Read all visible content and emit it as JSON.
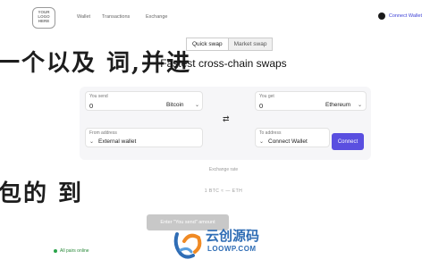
{
  "logo": {
    "line1": "YOUR",
    "line2": "LOGO",
    "line3": "HERE"
  },
  "nav": {
    "wallet": "Wallet",
    "transactions": "Transactions",
    "exchange": "Exchange"
  },
  "header": {
    "connect": "Connect Wallet"
  },
  "watermark": {
    "line1": "一个以及 词,并进",
    "line2": "包的 到"
  },
  "tabs": {
    "quick": "Quick swap",
    "market": "Market swap"
  },
  "subtitle": "Fastest cross-chain swaps",
  "send": {
    "label": "You send",
    "amount": "0",
    "currency": "Bitcoin"
  },
  "get": {
    "label": "You get",
    "amount": "0",
    "currency": "Ethereum"
  },
  "from": {
    "label": "From address",
    "value": "External wallet"
  },
  "to": {
    "label": "To address",
    "value": "Connect Wallet"
  },
  "buttons": {
    "connect": "Connect",
    "enter": "Enter \"You send\" amount"
  },
  "info": {
    "line1": "Exchange rate",
    "line2": "1 BTC ≈ — ETH"
  },
  "footer": {
    "status": "All pairs online"
  },
  "brand": {
    "name": "云创源码",
    "url": "LOOWP.COM"
  },
  "colors": {
    "accent": "#5a4fe0",
    "brand": "#2f6db5",
    "status": "#2aa44a"
  }
}
